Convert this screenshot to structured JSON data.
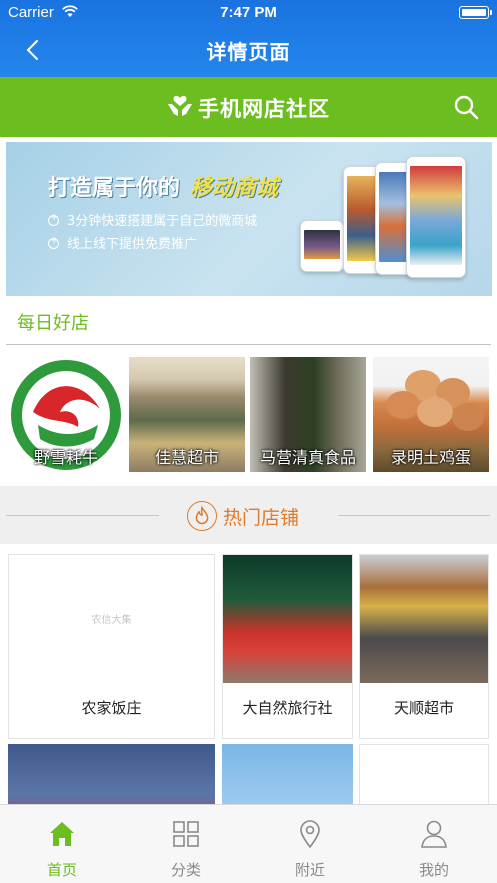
{
  "status_bar": {
    "carrier": "Carrier",
    "time": "7:47 PM"
  },
  "nav": {
    "title": "详情页面",
    "back_icon": "chevron-left-icon"
  },
  "community_header": {
    "title": "手机网店社区",
    "logo_icon": "hands-heart-logo",
    "search_icon": "search-icon"
  },
  "banner": {
    "headline": "打造属于你的",
    "headline_accent": "移动商城",
    "bullets": [
      "3分钟快速搭建属于自己的微商城",
      "线上线下提供免费推广"
    ]
  },
  "daily_shops": {
    "title": "每日好店",
    "items": [
      {
        "label": "野雪耗牛"
      },
      {
        "label": "佳慧超市"
      },
      {
        "label": "马营清真食品"
      },
      {
        "label": "录明土鸡蛋"
      }
    ]
  },
  "hot_shops": {
    "title": "热门店铺",
    "placeholder_text": "农信大集",
    "items": [
      {
        "label": "农家饭庄"
      },
      {
        "label": "大自然旅行社"
      },
      {
        "label": "天顺超市"
      },
      {
        "label": ""
      },
      {
        "label": ""
      },
      {
        "label": ""
      }
    ]
  },
  "tabbar": {
    "items": [
      {
        "label": "首页",
        "icon": "home-icon",
        "active": true
      },
      {
        "label": "分类",
        "icon": "grid-icon",
        "active": false
      },
      {
        "label": "附近",
        "icon": "location-pin-icon",
        "active": false
      },
      {
        "label": "我的",
        "icon": "person-icon",
        "active": false
      }
    ]
  },
  "colors": {
    "nav_blue": "#1a73e0",
    "brand_green": "#6cbd20",
    "hot_orange": "#e07a2a"
  }
}
